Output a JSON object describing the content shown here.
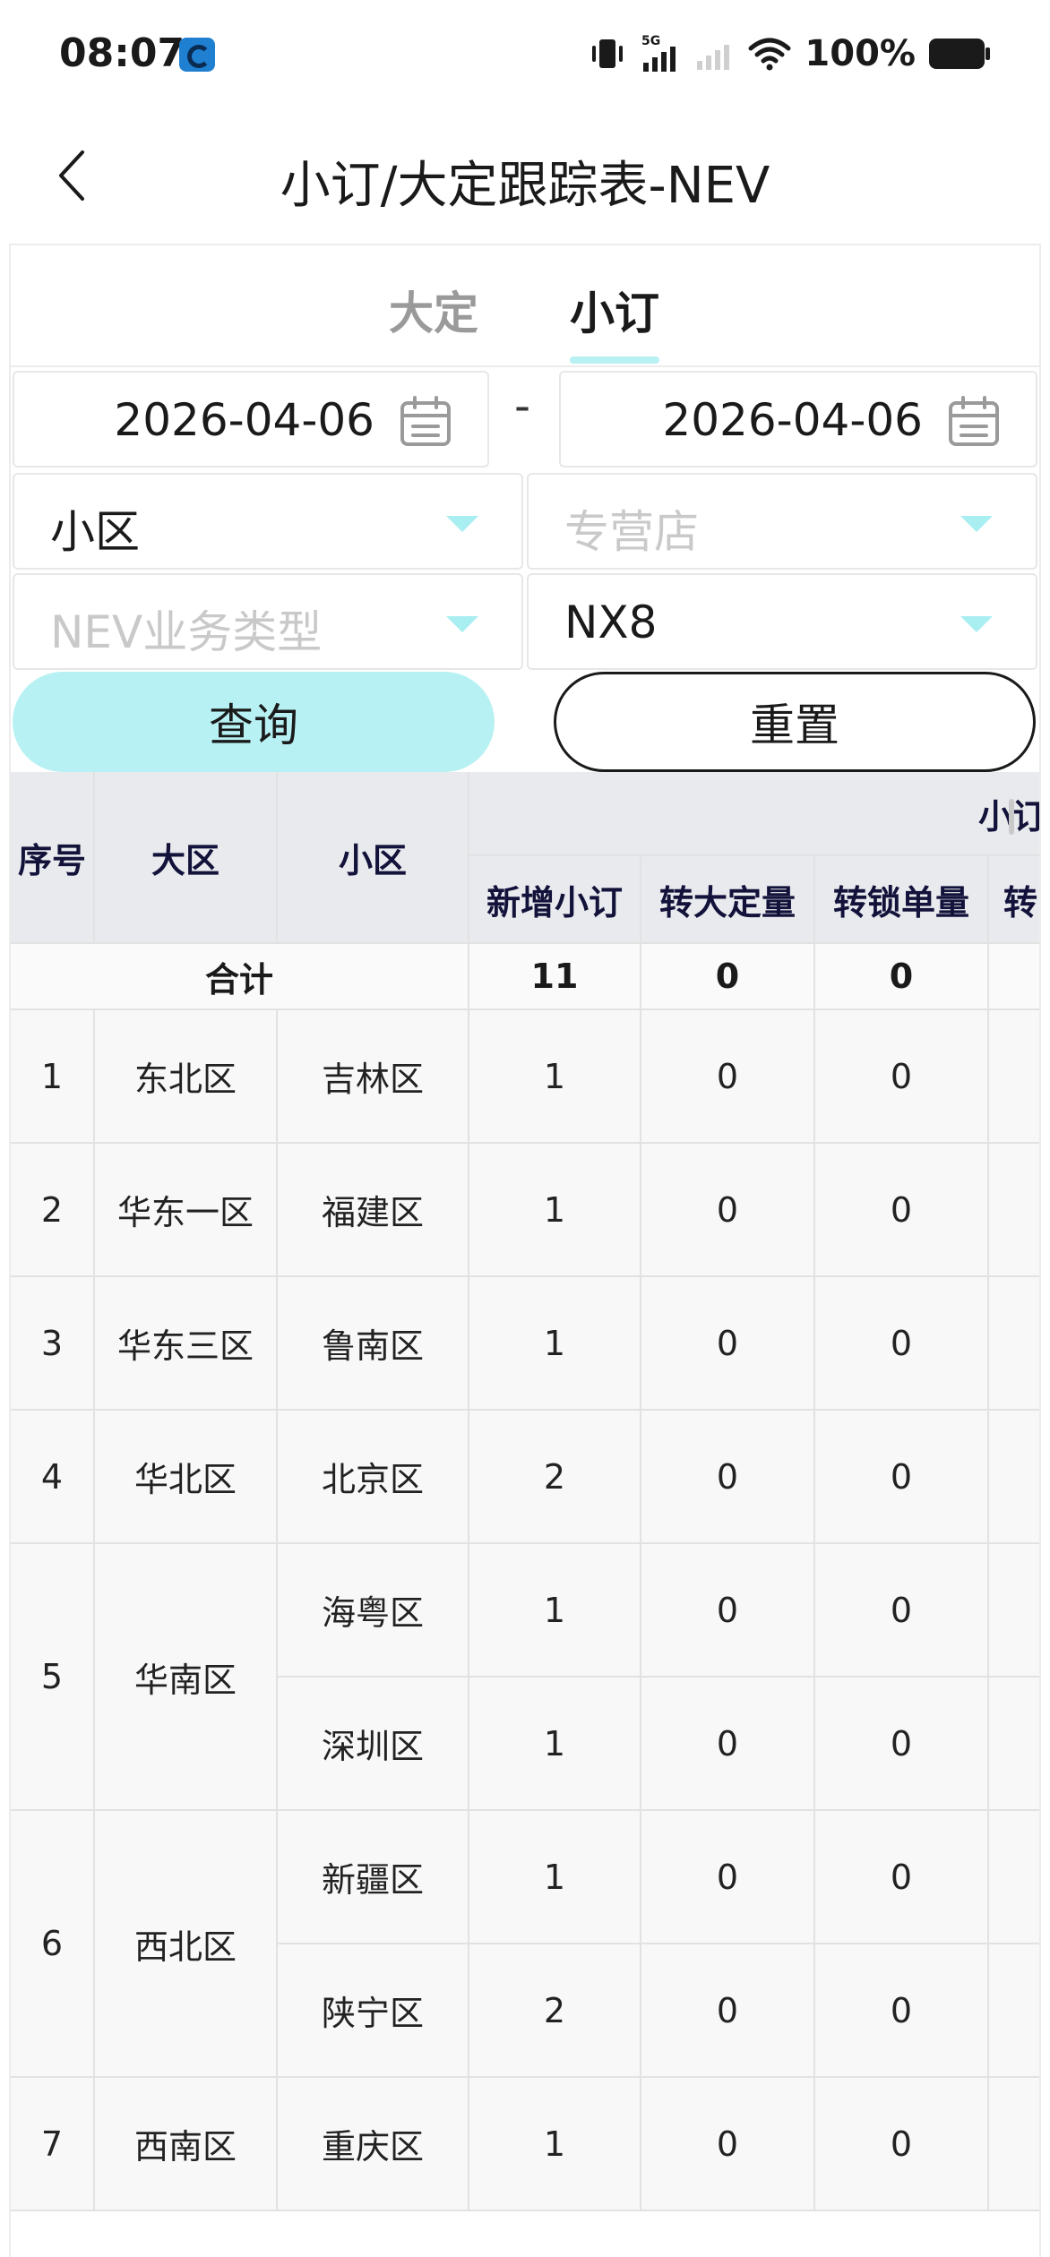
{
  "status_bar": {
    "time": "08:07",
    "network": "5G",
    "battery": "100%",
    "icons": [
      "vibrate-icon",
      "signal-5g-icon",
      "signal-empty-icon",
      "wifi-icon",
      "battery-icon"
    ]
  },
  "header": {
    "title": "小订/大定跟踪表-NEV",
    "back_icon": "chevron-left-icon"
  },
  "tabs": [
    {
      "label": "大定",
      "active": false
    },
    {
      "label": "小订",
      "active": true
    }
  ],
  "filters": {
    "start_date": "2026-04-06",
    "separator": "-",
    "end_date": "2026-04-06",
    "district": {
      "value": "小区"
    },
    "store": {
      "placeholder": "专营店"
    },
    "business_type": {
      "placeholder": "NEV业务类型"
    },
    "model": {
      "value": "NX8"
    }
  },
  "buttons": {
    "query": "查询",
    "reset": "重置"
  },
  "table": {
    "group_header": "小订",
    "headers": {
      "index": "序号",
      "region": "大区",
      "district": "小区",
      "new_orders": "新增小订",
      "to_big_order": "转大定量",
      "to_lock": "转锁单量",
      "truncated": "转"
    },
    "total": {
      "label": "合计",
      "new_orders": "11",
      "to_big_order": "0",
      "to_lock": "0"
    },
    "groups": [
      {
        "index": "1",
        "region": "东北区",
        "rows": [
          {
            "district": "吉林区",
            "new_orders": "1",
            "to_big_order": "0",
            "to_lock": "0"
          }
        ]
      },
      {
        "index": "2",
        "region": "华东一区",
        "rows": [
          {
            "district": "福建区",
            "new_orders": "1",
            "to_big_order": "0",
            "to_lock": "0"
          }
        ]
      },
      {
        "index": "3",
        "region": "华东三区",
        "rows": [
          {
            "district": "鲁南区",
            "new_orders": "1",
            "to_big_order": "0",
            "to_lock": "0"
          }
        ]
      },
      {
        "index": "4",
        "region": "华北区",
        "rows": [
          {
            "district": "北京区",
            "new_orders": "2",
            "to_big_order": "0",
            "to_lock": "0"
          }
        ]
      },
      {
        "index": "5",
        "region": "华南区",
        "rows": [
          {
            "district": "海粤区",
            "new_orders": "1",
            "to_big_order": "0",
            "to_lock": "0"
          },
          {
            "district": "深圳区",
            "new_orders": "1",
            "to_big_order": "0",
            "to_lock": "0"
          }
        ]
      },
      {
        "index": "6",
        "region": "西北区",
        "rows": [
          {
            "district": "新疆区",
            "new_orders": "1",
            "to_big_order": "0",
            "to_lock": "0"
          },
          {
            "district": "陕宁区",
            "new_orders": "2",
            "to_big_order": "0",
            "to_lock": "0"
          }
        ]
      },
      {
        "index": "7",
        "region": "西南区",
        "rows": [
          {
            "district": "重庆区",
            "new_orders": "1",
            "to_big_order": "0",
            "to_lock": "0"
          }
        ]
      }
    ]
  },
  "colors": {
    "accent": "#b8f1f3",
    "caret": "#a9eef1",
    "header_bg": "#e9eaee",
    "cell_bg": "#f8f8f8"
  }
}
